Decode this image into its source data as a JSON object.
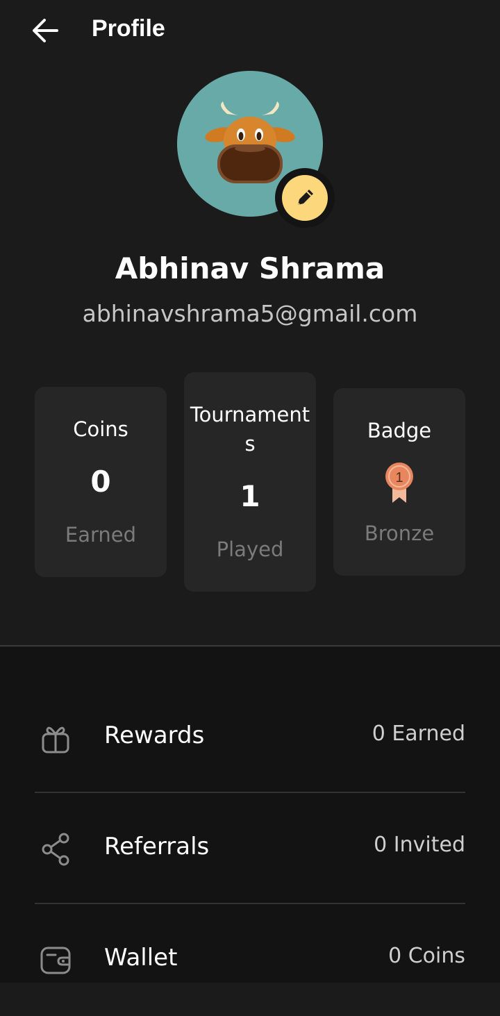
{
  "header": {
    "title": "Profile"
  },
  "profile": {
    "name": "Abhinav Shrama",
    "email": "abhinavshrama5@gmail.com"
  },
  "stats": {
    "coins": {
      "label": "Coins",
      "value": "0",
      "sub": "Earned"
    },
    "tournaments": {
      "label_line1": "Tournament",
      "label_line2": "s",
      "value": "1",
      "sub": "Played"
    },
    "badge": {
      "label": "Badge",
      "medal_number": "1",
      "sub": "Bronze"
    }
  },
  "menu": {
    "rewards": {
      "label": "Rewards",
      "value": "0 Earned",
      "icon": "gift-icon"
    },
    "referrals": {
      "label": "Referrals",
      "value": "0 Invited",
      "icon": "share-icon"
    },
    "wallet": {
      "label": "Wallet",
      "value": "0 Coins",
      "icon": "wallet-icon"
    }
  },
  "colors": {
    "background": "#1b1b1b",
    "card": "#262626",
    "avatar_bg": "#68aaa8",
    "edit_accent": "#fcd77c",
    "medal": "#e8875f"
  }
}
